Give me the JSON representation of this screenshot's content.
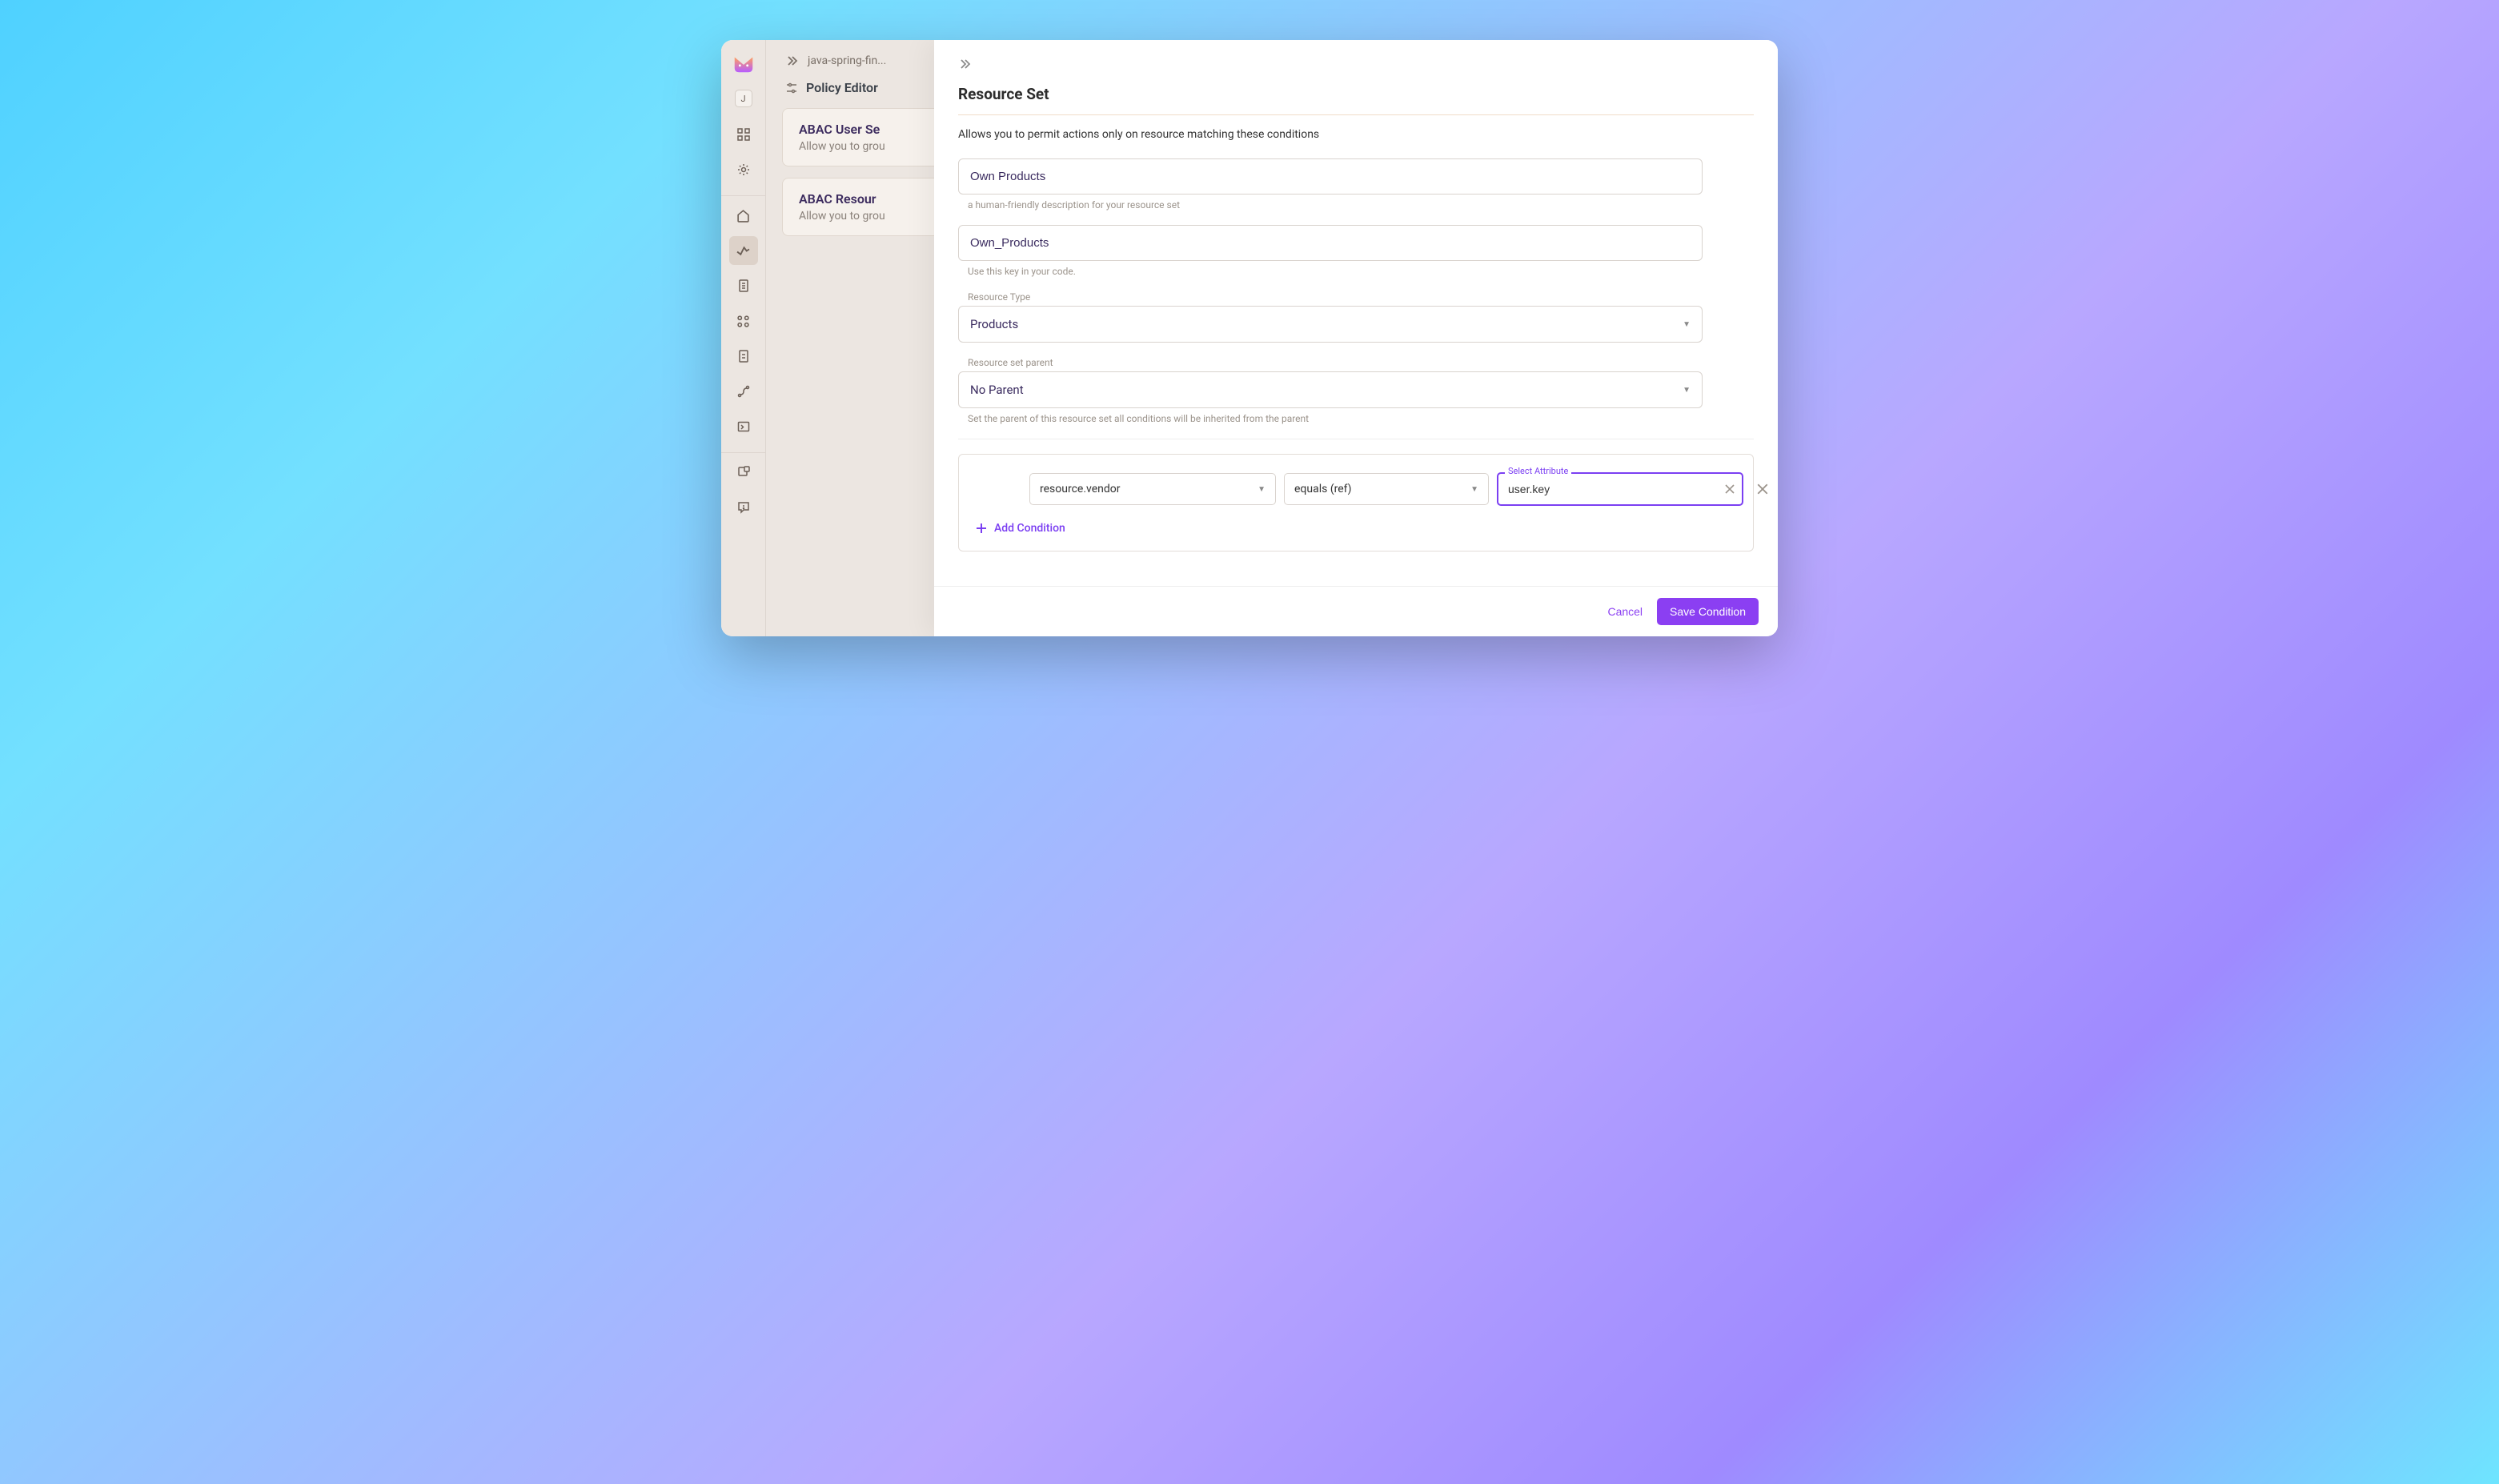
{
  "sidebar": {
    "avatar_initial": "J"
  },
  "breadcrumb": {
    "text": "java-spring-fin..."
  },
  "policy_editor_title": "Policy Editor",
  "cards": {
    "user": {
      "title": "ABAC User Se",
      "desc": "Allow you to grou"
    },
    "resource": {
      "title": "ABAC Resour",
      "desc": "Allow you to grou"
    }
  },
  "panel": {
    "title": "Resource Set",
    "description": "Allows you to permit actions only on resource matching these conditions",
    "name_value": "Own Products",
    "name_helper": "a human-friendly description for your resource set",
    "key_value": "Own_Products",
    "key_helper": "Use this key in your code.",
    "resource_type_label": "Resource Type",
    "resource_type_value": "Products",
    "parent_label": "Resource set parent",
    "parent_value": "No Parent",
    "parent_helper": "Set the parent of this resource set all conditions will be inherited from the parent",
    "condition": {
      "attribute_select": "resource.vendor",
      "operator": "equals (ref)",
      "value_label": "Select Attribute",
      "value": "user.key"
    },
    "add_condition_label": "Add Condition",
    "cancel_label": "Cancel",
    "save_label": "Save Condition"
  }
}
